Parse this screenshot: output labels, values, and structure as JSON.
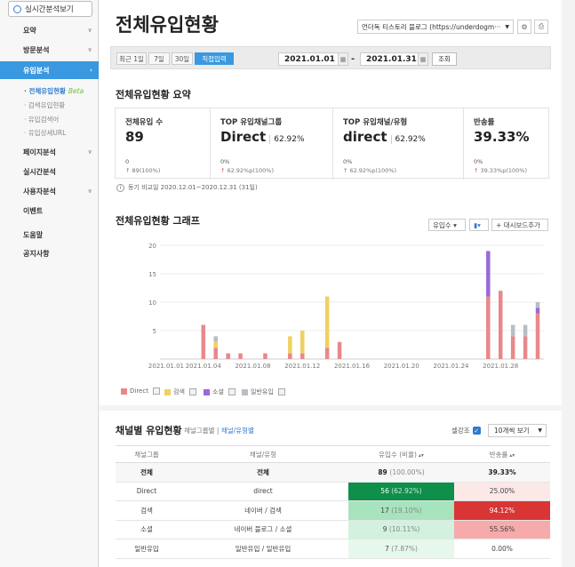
{
  "sidebar": {
    "realtime_button": "실시간분석보기",
    "items": [
      {
        "label": "요약",
        "chevron": "∨"
      },
      {
        "label": "방문분석",
        "chevron": "∨"
      },
      {
        "label": "유입분석",
        "chevron": "›"
      },
      {
        "label": "페이지분석",
        "chevron": "∨"
      },
      {
        "label": "실시간분석",
        "chevron": ""
      },
      {
        "label": "사용자분석",
        "chevron": "∨"
      },
      {
        "label": "이벤트",
        "chevron": ""
      },
      {
        "label": "도움말",
        "chevron": ""
      },
      {
        "label": "공지사항",
        "chevron": ""
      }
    ],
    "subitems": [
      "전체유입현황",
      "검색유입현황",
      "유입검색어",
      "유입상세URL"
    ],
    "beta_label": "Beta"
  },
  "header": {
    "title": "전체유입현황",
    "site_select": "언더독 티스토리 블로그 (https://underdogm···",
    "settings_icon": "⚙",
    "print_icon": "⎙"
  },
  "date_bar": {
    "ranges": [
      "최근 1일",
      "7일",
      "30일",
      "직접입력"
    ],
    "start": "2021.01.01",
    "end": "2021.01.31",
    "dash": "-",
    "query": "조회"
  },
  "summary": {
    "title": "전체유입현황 요약",
    "cols": [
      {
        "label": "전체유입 수",
        "value": "89",
        "pct": "",
        "sub1": "0",
        "sub2": "89(100%)"
      },
      {
        "label": "TOP 유입채널그룹",
        "value": "Direct",
        "pct": "62.92%",
        "sub1": "0%",
        "sub2": "62.92%p(100%)"
      },
      {
        "label": "TOP 유입채널/유형",
        "value": "direct",
        "pct": "62.92%",
        "sub1": "0%",
        "sub2": "62.92%p(100%)"
      },
      {
        "label": "반송률",
        "value": "39.33%",
        "pct": "",
        "sub1": "0%",
        "sub2": "39.33%p(100%)"
      }
    ],
    "compare_note": "동기 비교일 2020.12.01~2020.12.31 (31일)"
  },
  "chart": {
    "title": "전체유입현황 그래프",
    "metric_select": "유입수",
    "add_dashboard": "+ 대시보드추가",
    "legend": [
      {
        "label": "Direct",
        "color": "#e8888a"
      },
      {
        "label": "검색",
        "color": "#f0d060"
      },
      {
        "label": "소셜",
        "color": "#9b6ad6"
      },
      {
        "label": "일반유입",
        "color": "#b8bec6"
      }
    ]
  },
  "chart_data": {
    "type": "bar",
    "stacked": true,
    "ylim": [
      0,
      20
    ],
    "yticks": [
      5,
      10,
      15,
      20
    ],
    "xtick_labels": [
      "2021.01.01",
      "2021.01.04",
      "2021.01.08",
      "2021.01.12",
      "2021.01.16",
      "2021.01.20",
      "2021.01.24",
      "2021.01.28"
    ],
    "categories": [
      "01.01",
      "01.02",
      "01.03",
      "01.04",
      "01.05",
      "01.06",
      "01.07",
      "01.08",
      "01.09",
      "01.10",
      "01.11",
      "01.12",
      "01.13",
      "01.14",
      "01.15",
      "01.16",
      "01.17",
      "01.18",
      "01.19",
      "01.20",
      "01.21",
      "01.22",
      "01.23",
      "01.24",
      "01.25",
      "01.26",
      "01.27",
      "01.28",
      "01.29",
      "01.30",
      "01.31"
    ],
    "series": [
      {
        "name": "Direct",
        "values": [
          0,
          0,
          0,
          6,
          2,
          1,
          1,
          0,
          1,
          0,
          1,
          1,
          0,
          2,
          3,
          0,
          0,
          0,
          0,
          0,
          0,
          0,
          0,
          0,
          0,
          0,
          11,
          12,
          4,
          4,
          8
        ]
      },
      {
        "name": "검색",
        "values": [
          0,
          0,
          0,
          0,
          1,
          0,
          0,
          0,
          0,
          0,
          3,
          4,
          0,
          9,
          0,
          0,
          0,
          0,
          0,
          0,
          0,
          0,
          0,
          0,
          0,
          0,
          0,
          0,
          0,
          0,
          0
        ]
      },
      {
        "name": "소셜",
        "values": [
          0,
          0,
          0,
          0,
          0,
          0,
          0,
          0,
          0,
          0,
          0,
          0,
          0,
          0,
          0,
          0,
          0,
          0,
          0,
          0,
          0,
          0,
          0,
          0,
          0,
          0,
          8,
          0,
          0,
          0,
          1
        ]
      },
      {
        "name": "일반유입",
        "values": [
          0,
          0,
          0,
          0,
          1,
          0,
          0,
          0,
          0,
          0,
          0,
          0,
          0,
          0,
          0,
          0,
          0,
          0,
          0,
          0,
          0,
          0,
          0,
          0,
          0,
          0,
          0,
          0,
          2,
          2,
          1
        ]
      }
    ]
  },
  "channel_table": {
    "title": "채널별 유입현황",
    "filter_prefix": "채널그룹별 |",
    "filter_active": "채널/유형별",
    "highlight_label": "셀강조",
    "view_select": "10개씩 보기",
    "headers": [
      "채널그룹",
      "채널/유형",
      "유입수 (비율)",
      "반송률"
    ],
    "rows": [
      {
        "group": "전체",
        "type": "전체",
        "count": "89",
        "ratio": "(100.00%)",
        "bounce": "39.33%",
        "count_bg": "#f7f7f7",
        "bounce_bg": "#f7f7f7"
      },
      {
        "group": "Direct",
        "type": "direct",
        "count": "56",
        "ratio": "(62.92%)",
        "bounce": "25.00%",
        "count_bg": "#0e8f4a",
        "bounce_bg": "#fde8e8"
      },
      {
        "group": "검색",
        "type": "네이버 / 검색",
        "count": "17",
        "ratio": "(19.10%)",
        "bounce": "94.12%",
        "count_bg": "#a7e3bd",
        "bounce_bg": "#d93535"
      },
      {
        "group": "소셜",
        "type": "네이버 블로그 / 소셜",
        "count": "9",
        "ratio": "(10.11%)",
        "bounce": "55.56%",
        "count_bg": "#d2f1de",
        "bounce_bg": "#f7aaaa"
      },
      {
        "group": "일반유입",
        "type": "일반유입 / 일반유입",
        "count": "7",
        "ratio": "(7.87%)",
        "bounce": "0.00%",
        "count_bg": "#e6f7ec",
        "bounce_bg": "#ffffff"
      }
    ]
  }
}
